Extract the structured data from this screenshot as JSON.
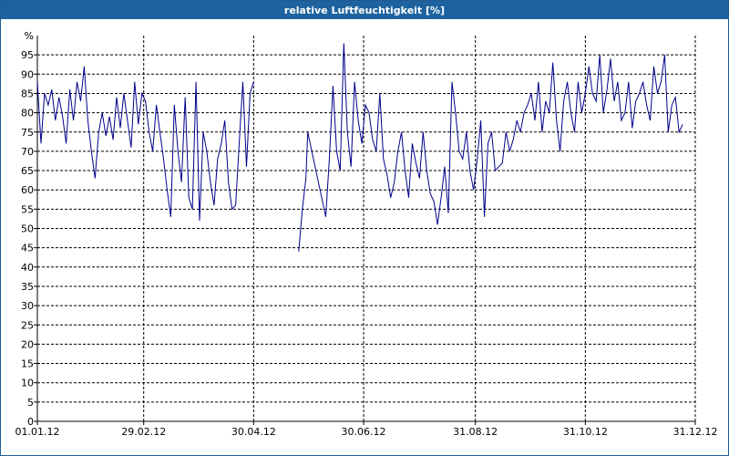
{
  "window": {
    "title": "relative Luftfeuchtigkeit [%]"
  },
  "colors": {
    "titlebar": "#1e63a0",
    "line": "#00008b",
    "grid": "#000000",
    "axis": "#000000"
  },
  "chart_data": {
    "type": "line",
    "title": "relative Luftfeuchtigkeit [%]",
    "ylabel": "%",
    "xlabel": "",
    "ylim": [
      0,
      100
    ],
    "y_ticks": [
      0,
      5,
      10,
      15,
      20,
      25,
      30,
      35,
      40,
      45,
      50,
      55,
      60,
      65,
      70,
      75,
      80,
      85,
      90,
      95
    ],
    "x_ticks": [
      {
        "day": 0,
        "label": "01.01.12"
      },
      {
        "day": 59,
        "label": "29.02.12"
      },
      {
        "day": 120,
        "label": "30.04.12"
      },
      {
        "day": 181,
        "label": "30.06.12"
      },
      {
        "day": 243,
        "label": "31.08.12"
      },
      {
        "day": 304,
        "label": "31.10.12"
      },
      {
        "day": 365,
        "label": "31.12.12"
      }
    ],
    "grid": true,
    "x": [
      0,
      2,
      4,
      6,
      8,
      10,
      12,
      14,
      16,
      18,
      20,
      22,
      24,
      26,
      28,
      30,
      32,
      34,
      36,
      38,
      40,
      42,
      44,
      46,
      48,
      50,
      52,
      54,
      56,
      58,
      60,
      62,
      64,
      66,
      68,
      70,
      72,
      74,
      76,
      78,
      80,
      82,
      84,
      86,
      88,
      90,
      92,
      94,
      96,
      98,
      100,
      102,
      104,
      106,
      108,
      110,
      112,
      114,
      116,
      118,
      120,
      122,
      124,
      126,
      128,
      145,
      147,
      149,
      150,
      160,
      162,
      164,
      166,
      168,
      170,
      172,
      174,
      176,
      178,
      180,
      182,
      184,
      186,
      188,
      190,
      192,
      194,
      196,
      198,
      200,
      202,
      204,
      206,
      208,
      210,
      212,
      214,
      216,
      218,
      220,
      222,
      224,
      226,
      228,
      230,
      232,
      234,
      236,
      238,
      240,
      242,
      244,
      246,
      248,
      250,
      252,
      254,
      256,
      258,
      260,
      262,
      264,
      266,
      268,
      270,
      272,
      274,
      276,
      278,
      280,
      282,
      284,
      286,
      288,
      290,
      292,
      294,
      296,
      298,
      300,
      302,
      304,
      306,
      308,
      310,
      312,
      314,
      316,
      318,
      320,
      322,
      324,
      326,
      328,
      330,
      332,
      334,
      336,
      338,
      340,
      342,
      344,
      346,
      348,
      350,
      352,
      354,
      356,
      358,
      360,
      362,
      364,
      365
    ],
    "values": [
      88,
      72,
      85,
      82,
      86,
      78,
      84,
      79,
      72,
      86,
      78,
      88,
      83,
      92,
      78,
      70,
      63,
      75,
      80,
      74,
      79,
      73,
      84,
      76,
      85,
      78,
      71,
      88,
      77,
      85,
      83,
      75,
      70,
      82,
      75,
      68,
      60,
      53,
      82,
      70,
      62,
      84,
      58,
      55,
      88,
      52,
      75,
      70,
      62,
      56,
      68,
      72,
      78,
      62,
      55,
      56,
      72,
      88,
      66,
      85,
      88,
      null,
      null,
      null,
      null,
      44,
      55,
      63,
      75,
      53,
      68,
      87,
      70,
      65,
      98,
      75,
      66,
      88,
      78,
      72,
      82,
      80,
      73,
      70,
      85,
      68,
      64,
      58,
      62,
      70,
      75,
      65,
      58,
      72,
      67,
      63,
      75,
      65,
      59,
      57,
      51,
      58,
      66,
      54,
      88,
      80,
      70,
      68,
      75,
      65,
      60,
      68,
      78,
      53,
      72,
      75,
      65,
      66,
      67,
      75,
      70,
      73,
      78,
      75,
      80,
      82,
      85,
      78,
      88,
      75,
      83,
      80,
      93,
      78,
      70,
      83,
      88,
      80,
      75,
      88,
      80,
      85,
      92,
      85,
      83,
      95,
      80,
      86,
      94,
      83,
      88,
      78,
      80,
      88,
      76,
      83,
      85,
      88,
      82,
      78,
      92,
      85,
      88,
      95,
      75,
      82,
      84,
      75,
      77
    ]
  }
}
